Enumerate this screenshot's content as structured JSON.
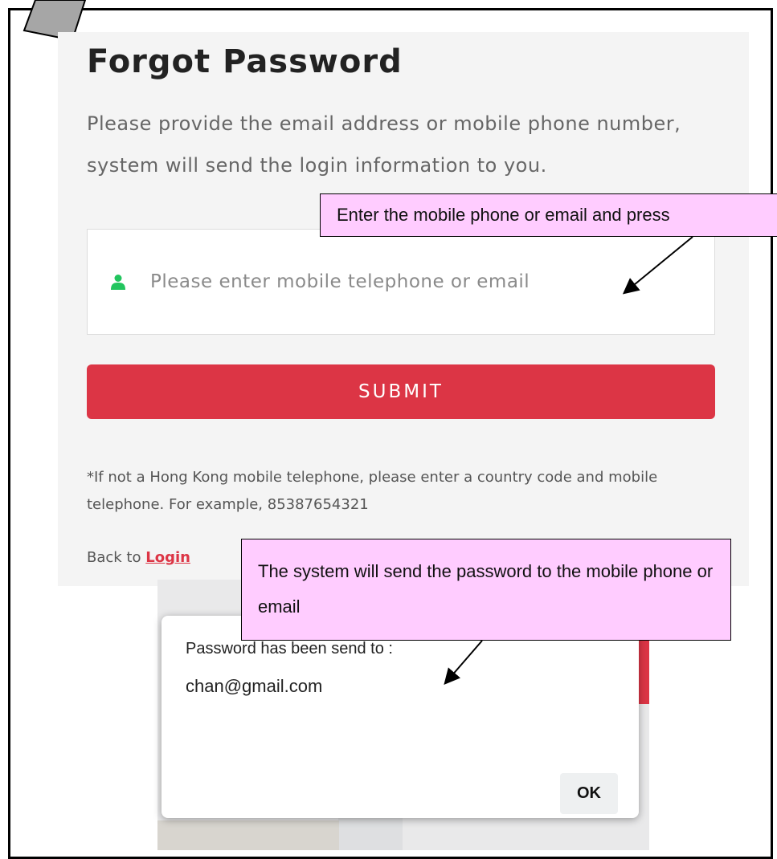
{
  "form": {
    "title": "Forgot Password",
    "description": "Please provide the email address or mobile phone number, system will send the login information to you.",
    "input_placeholder": "Please enter mobile telephone or email",
    "submit_label": "SUBMIT",
    "note": "*If not a Hong Kong mobile telephone, please enter a country code and mobile telephone. For example, 85387654321",
    "back_text": "Back to",
    "login_link": "Login"
  },
  "callouts": {
    "enter_hint": "Enter the mobile phone or email and press",
    "send_hint": "The system will send the password to the mobile phone or email"
  },
  "dialog": {
    "message": "Password has been send to :",
    "email": "chan@gmail.com",
    "ok_label": "OK"
  },
  "colors": {
    "accent": "#dc3545",
    "callout_bg": "#ffccff",
    "user_icon": "#22c55e"
  },
  "icons": {
    "input_icon": "user-icon"
  }
}
